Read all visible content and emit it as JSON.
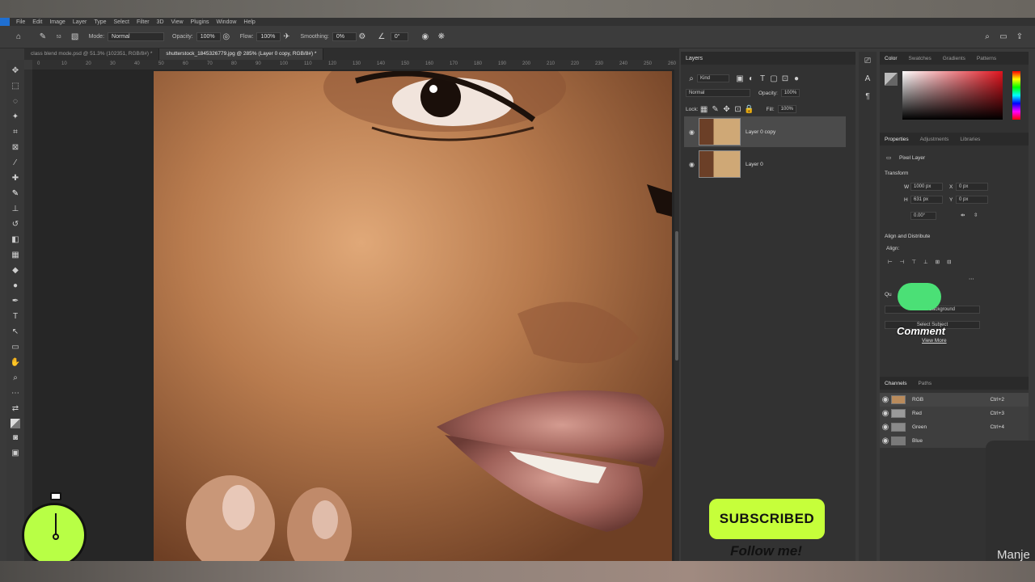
{
  "menu": [
    "File",
    "Edit",
    "Image",
    "Layer",
    "Type",
    "Select",
    "Filter",
    "3D",
    "View",
    "Plugins",
    "Window",
    "Help"
  ],
  "options": {
    "mode_label": "Mode:",
    "mode_value": "Normal",
    "opacity_label": "Opacity:",
    "opacity_value": "100%",
    "flow_label": "Flow:",
    "flow_value": "100%",
    "smoothing_label": "Smoothing:",
    "smoothing_value": "0%",
    "angle_value": "0°",
    "brush_size": "53"
  },
  "tabs": [
    {
      "label": "class blend mode.psd @ 51.3% (102351, RGB/8#) *",
      "active": false
    },
    {
      "label": "shutterstock_1845326779.jpg @ 285% (Layer 0 copy, RGB/8#) *",
      "active": true
    }
  ],
  "ruler_h": [
    "0",
    "10",
    "20",
    "30",
    "40",
    "50",
    "60",
    "70",
    "80",
    "90",
    "100",
    "110",
    "120",
    "130",
    "140",
    "150",
    "160",
    "170",
    "180",
    "190",
    "200",
    "210",
    "220",
    "230",
    "240",
    "250",
    "260"
  ],
  "layers_panel": {
    "title": "Layers",
    "filter_kind": "Kind",
    "blend_mode": "Normal",
    "opacity_label": "Opacity:",
    "opacity_value": "100%",
    "lock_label": "Lock:",
    "fill_label": "Fill:",
    "fill_value": "100%",
    "layers": [
      {
        "name": "Layer 0 copy",
        "selected": true
      },
      {
        "name": "Layer 0",
        "selected": false
      }
    ]
  },
  "color_panel": {
    "tabs": [
      "Color",
      "Swatches",
      "Gradients",
      "Patterns"
    ]
  },
  "properties_panel": {
    "tabs": [
      "Properties",
      "Adjustments",
      "Libraries"
    ],
    "kind": "Pixel Layer",
    "transform_title": "Transform",
    "w_label": "W",
    "w_value": "1000 px",
    "h_label": "H",
    "h_value": "631 px",
    "x_label": "X",
    "x_value": "0 px",
    "y_label": "Y",
    "y_value": "0 px",
    "angle_value": "0.00°",
    "align_title": "Align and Distribute",
    "align_label": "Align:",
    "quick_actions_title": "Qu",
    "remove_bg": "Remove Background",
    "select_subject": "Select Subject",
    "view_more": "View More"
  },
  "channels_panel": {
    "tabs": [
      "Channels",
      "Paths"
    ],
    "channels": [
      {
        "name": "RGB",
        "shortcut": "Ctrl+2",
        "color": "#b98b5c"
      },
      {
        "name": "Red",
        "shortcut": "Ctrl+3",
        "color": "#9a9a9a"
      },
      {
        "name": "Green",
        "shortcut": "Ctrl+4",
        "color": "#8a8a8a"
      },
      {
        "name": "Blue",
        "shortcut": "Ctrl+5",
        "color": "#7a7a7a"
      }
    ]
  },
  "overlay": {
    "subscribed": "SUBSCRIBED",
    "follow": "Follow me!",
    "comment": "Comment",
    "corner_name": "Manje"
  },
  "colors": {
    "accent_green": "#c6ff3a",
    "ps_blue": "#1f6fd1"
  }
}
